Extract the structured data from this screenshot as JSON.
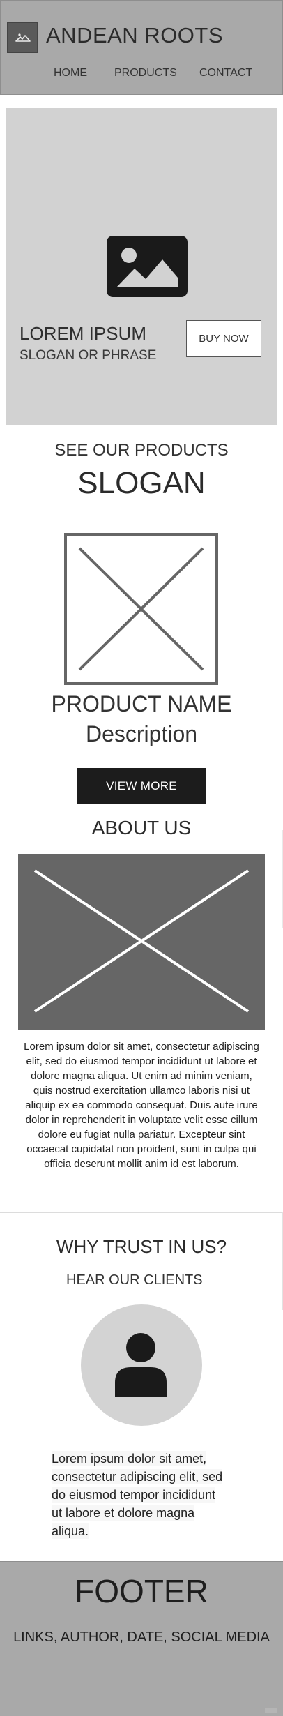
{
  "header": {
    "brand": "ANDEAN ROOTS",
    "nav": [
      "HOME",
      "PRODUCTS",
      "CONTACT"
    ]
  },
  "hero": {
    "title": "LOREM IPSUM",
    "subtitle": "SLOGAN OR PHRASE",
    "cta": "BUY NOW",
    "image_icon": "image-icon"
  },
  "products": {
    "heading": "SEE OUR PRODUCTS",
    "slogan": "SLOGAN",
    "product_name": "PRODUCT NAME",
    "product_description": "Description",
    "view_more": "VIEW MORE"
  },
  "about": {
    "heading": "ABOUT US",
    "text": "Lorem ipsum dolor sit amet, consectetur adipiscing elit, sed do eiusmod tempor incididunt ut labore et dolore magna aliqua. Ut enim ad minim veniam, quis nostrud exercitation ullamco laboris nisi ut aliquip ex ea commodo consequat. Duis aute irure dolor in reprehenderit in voluptate velit esse cillum dolore eu fugiat nulla pariatur. Excepteur sint occaecat cupidatat non proident, sunt in culpa qui officia deserunt mollit anim id est laborum."
  },
  "testimonials": {
    "heading": "WHY TRUST IN US?",
    "subheading": "HEAR OUR CLIENTS",
    "avatar_icon": "user-icon",
    "quote_lines": [
      "Lorem ipsum dolor sit amet,",
      "consectetur adipiscing elit, sed",
      "do eiusmod tempor incididunt",
      "ut labore et dolore magna",
      "aliqua."
    ]
  },
  "footer": {
    "title": "FOOTER",
    "links": "LINKS, AUTHOR, DATE, SOCIAL MEDIA"
  },
  "colors": {
    "header_bg": "#a9a9a9",
    "hero_bg": "#d2d2d2",
    "placeholder_dark": "#6a6a6a",
    "button_dark": "#1c1c1c",
    "footer_bg": "#a9a9a9"
  }
}
